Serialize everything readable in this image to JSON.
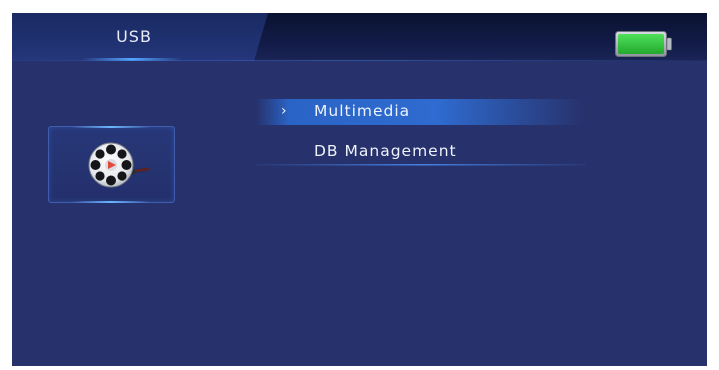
{
  "header": {
    "tab_title": "USB",
    "battery": {
      "level": 1.0,
      "color": "#2fc53a",
      "icon": "battery-icon"
    }
  },
  "sidebar": {
    "icon": "film-reel-icon"
  },
  "menu": {
    "items": [
      {
        "arrow": "›",
        "label": "Multimedia",
        "selected": true
      },
      {
        "arrow": "",
        "label": "DB Management",
        "selected": false
      }
    ]
  },
  "colors": {
    "background": "#27316b",
    "header": "#111a44",
    "highlight": "#2f6bd0",
    "accent": "#52a6ff"
  }
}
